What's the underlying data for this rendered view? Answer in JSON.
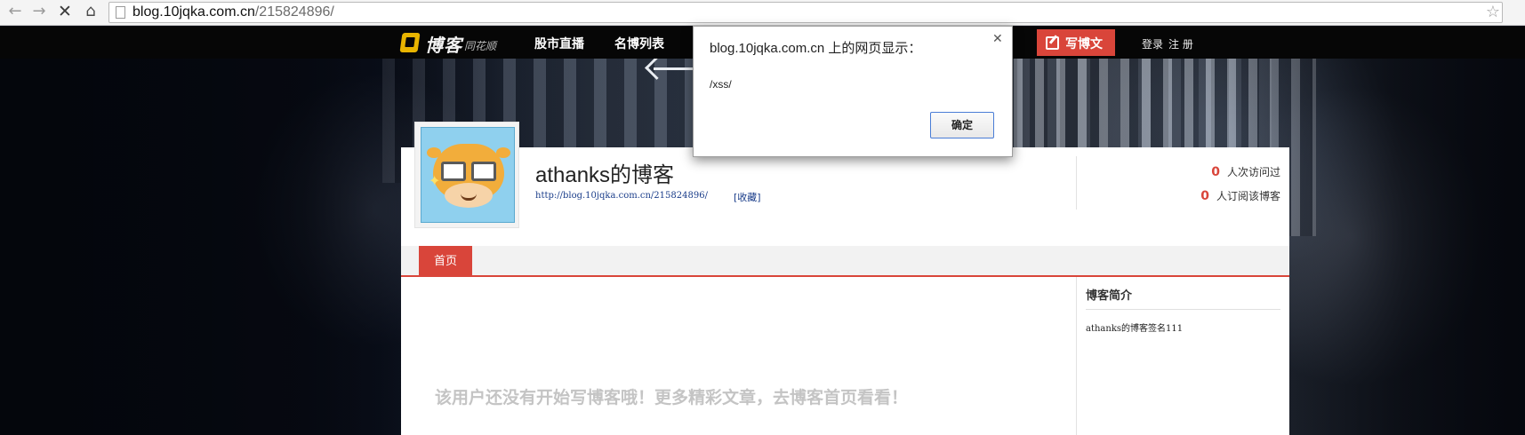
{
  "browser": {
    "url_host": "blog.10jqka.com.cn",
    "url_path": "/215824896/"
  },
  "site": {
    "logo_main": "博客",
    "logo_sub": "同花顺",
    "nav": [
      "股市直播",
      "名博列表"
    ],
    "write_label": "写博文",
    "login_label": "登录",
    "register_label": "注 册"
  },
  "blog": {
    "title": "athanks的博客",
    "url": "http://blog.10jqka.com.cn/215824896/",
    "bookmark_label": "[收藏]",
    "visits_count": "0",
    "visits_label": "人次访问过",
    "subscribers_count": "0",
    "subscribers_label": "人订阅该博客",
    "tab_home": "首页",
    "intro_title": "博客简介",
    "intro_text": "athanks的博客签名111",
    "empty_message": "该用户还没有开始写博客哦！更多精彩文章，去博客首页看看！"
  },
  "dialog": {
    "title": "blog.10jqka.com.cn 上的网页显示：",
    "message": "/xss/",
    "ok_label": "确定"
  },
  "colors": {
    "accent": "#d9453a",
    "topnav": "#060606"
  }
}
